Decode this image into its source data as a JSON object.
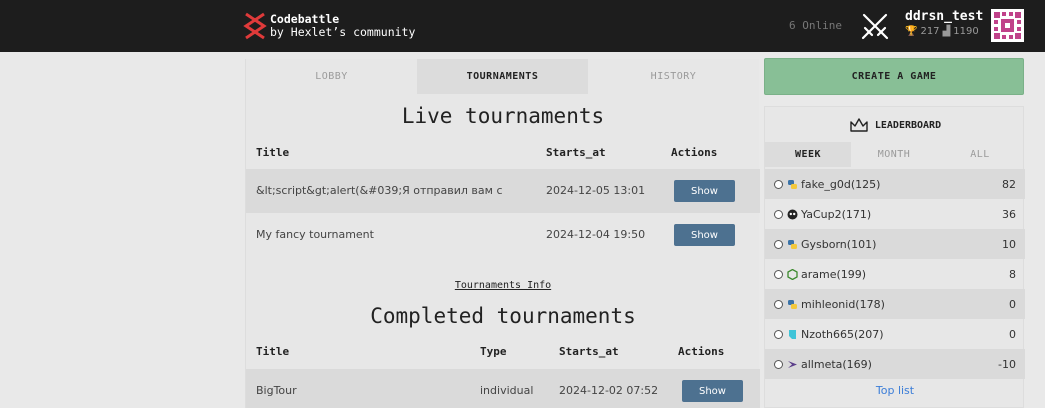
{
  "header": {
    "logo_line1": "Codebattle",
    "logo_line2": "by Hexlet’s community",
    "online": "6 Online",
    "username": "ddrsn_test",
    "trophies": "217",
    "rating": "1190"
  },
  "tabs": [
    "LOBBY",
    "TOURNAMENTS",
    "HISTORY"
  ],
  "live": {
    "title": "Live tournaments",
    "headers": {
      "title": "Title",
      "starts_at": "Starts_at",
      "actions": "Actions"
    },
    "rows": [
      {
        "title": "&lt;script&gt;alert(&#039;Я отправил вам с",
        "starts_at": "2024-12-05 13:01",
        "action": "Show"
      },
      {
        "title": "My fancy tournament",
        "starts_at": "2024-12-04 19:50",
        "action": "Show"
      }
    ]
  },
  "info_link": "Tournaments Info",
  "completed": {
    "title": "Completed tournaments",
    "headers": {
      "title": "Title",
      "type": "Type",
      "starts_at": "Starts_at",
      "actions": "Actions"
    },
    "rows": [
      {
        "title": "BigTour",
        "type": "individual",
        "starts_at": "2024-12-02 07:52",
        "action": "Show"
      }
    ]
  },
  "create_game": "CREATE A GAME",
  "leaderboard": {
    "title": "LEADERBOARD",
    "tabs": [
      "WEEK",
      "MONTH",
      "ALL"
    ],
    "rows": [
      {
        "name": "fake_g0d(125)",
        "score": "82",
        "lang_icon": "python-icon"
      },
      {
        "name": "YaCup2(171)",
        "score": "36",
        "lang_icon": "skull-icon"
      },
      {
        "name": "Gysborn(101)",
        "score": "10",
        "lang_icon": "python-icon"
      },
      {
        "name": "arame(199)",
        "score": "8",
        "lang_icon": "nodejs-icon"
      },
      {
        "name": "mihleonid(178)",
        "score": "0",
        "lang_icon": "python-icon"
      },
      {
        "name": "Nzoth665(207)",
        "score": "0",
        "lang_icon": "dart-icon"
      },
      {
        "name": "allmeta(169)",
        "score": "-10",
        "lang_icon": "elixir-icon"
      }
    ],
    "top_list": "Top list"
  },
  "colors": {
    "navbar": "#1d1d1d",
    "accent_green": "#88bf96",
    "button_blue": "#4d7190",
    "link_blue": "#3b7dd8"
  }
}
